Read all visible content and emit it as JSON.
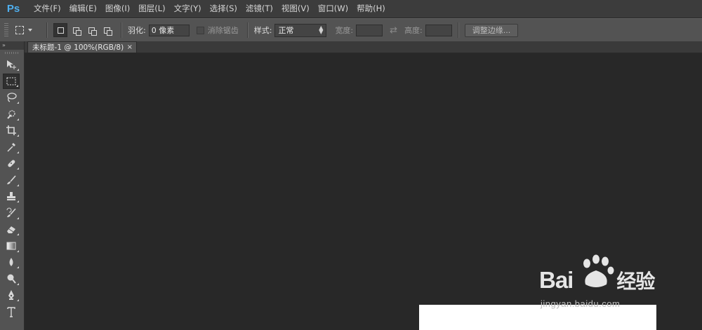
{
  "app": {
    "logo": "Ps",
    "accent": "#4fb0f0"
  },
  "menu": [
    "文件(F)",
    "编辑(E)",
    "图像(I)",
    "图层(L)",
    "文字(Y)",
    "选择(S)",
    "滤镜(T)",
    "视图(V)",
    "窗口(W)",
    "帮助(H)"
  ],
  "options": {
    "feather_label": "羽化:",
    "feather_value": "0 像素",
    "antialias_label": "消除锯齿",
    "style_label": "样式:",
    "style_value": "正常",
    "width_label": "宽度:",
    "height_label": "高度:",
    "refine_button": "调整边缘..."
  },
  "toolbar": {
    "collapse": "»",
    "tools": [
      "move-icon",
      "marquee-icon",
      "lasso-icon",
      "quick-select-icon",
      "crop-icon",
      "eyedropper-icon",
      "healing-icon",
      "brush-icon",
      "stamp-icon",
      "history-brush-icon",
      "eraser-icon",
      "gradient-icon",
      "blur-icon",
      "dodge-icon",
      "pen-icon",
      "type-icon"
    ]
  },
  "document": {
    "tab_title": "未标题-1 @ 100%(RGB/8)",
    "close": "×"
  },
  "watermark": {
    "brand": "Bai",
    "brand2": "经验",
    "url": "jingyan.baidu.com"
  }
}
